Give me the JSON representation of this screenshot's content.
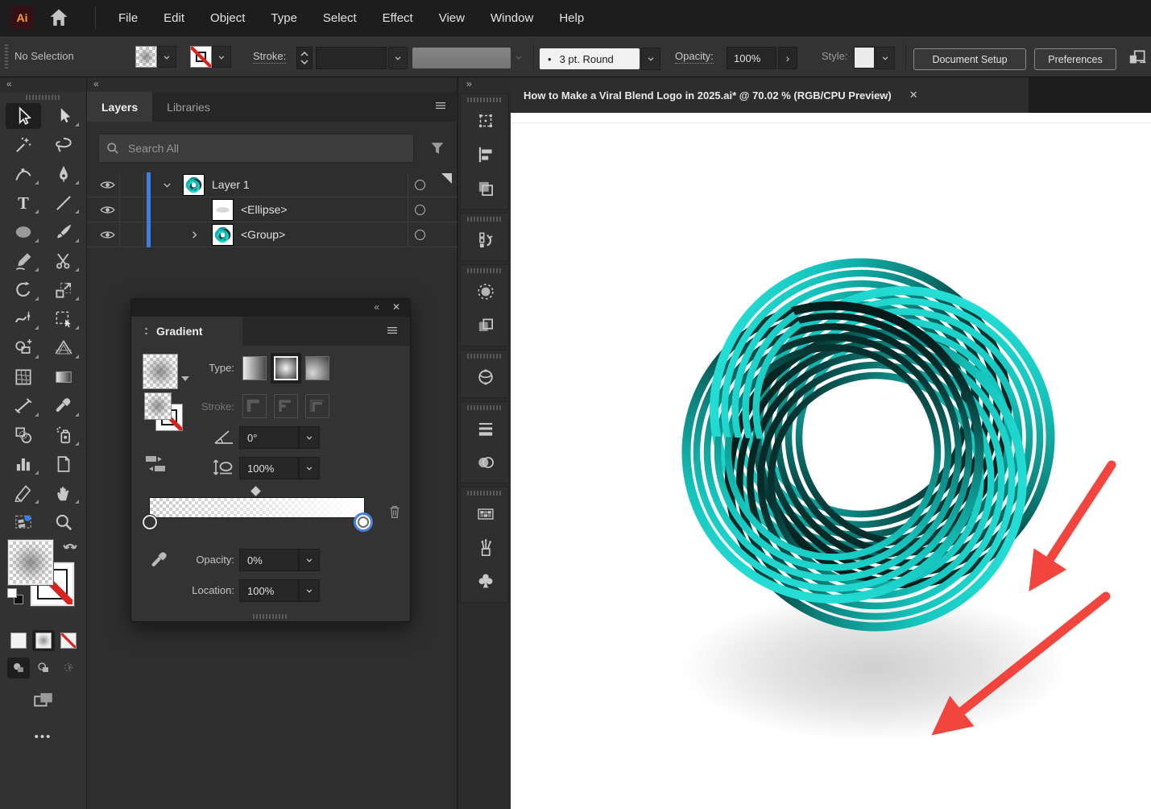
{
  "menu_bar": {
    "app_badge": "Ai",
    "items": [
      "File",
      "Edit",
      "Object",
      "Type",
      "Select",
      "Effect",
      "View",
      "Window",
      "Help"
    ]
  },
  "control_bar": {
    "selection_status": "No Selection",
    "stroke_label": "Stroke:",
    "stroke_point_bullet": "•",
    "stroke_point_label": "3 pt. Round",
    "opacity_label": "Opacity:",
    "opacity_value": "100%",
    "opacity_expand_glyph": "›",
    "style_label": "Style:",
    "document_setup_label": "Document Setup",
    "preferences_label": "Preferences"
  },
  "toolbar": {
    "collapse_glyph": "«",
    "tools": [
      {
        "name": "selection-tool",
        "active": true,
        "corner": false
      },
      {
        "name": "direct-selection-tool",
        "corner": true
      },
      {
        "name": "magic-wand-tool",
        "corner": false
      },
      {
        "name": "lasso-tool",
        "corner": false
      },
      {
        "name": "curvature-tool",
        "corner": true
      },
      {
        "name": "pen-tool",
        "corner": true
      },
      {
        "name": "type-tool",
        "corner": true
      },
      {
        "name": "line-segment-tool",
        "corner": true
      },
      {
        "name": "ellipse-tool",
        "corner": true
      },
      {
        "name": "paintbrush-tool",
        "corner": true
      },
      {
        "name": "shaper-tool",
        "corner": true
      },
      {
        "name": "scissors-tool",
        "corner": true
      },
      {
        "name": "rotate-tool",
        "corner": true
      },
      {
        "name": "scale-tool",
        "corner": true
      },
      {
        "name": "width-tool",
        "corner": true
      },
      {
        "name": "free-transform-tool",
        "corner": true
      },
      {
        "name": "shape-builder-tool",
        "corner": true
      },
      {
        "name": "perspective-grid-tool",
        "corner": true
      },
      {
        "name": "mesh-tool",
        "corner": false
      },
      {
        "name": "gradient-tool",
        "corner": false
      },
      {
        "name": "measure-tool",
        "corner": true
      },
      {
        "name": "eyedropper-tool",
        "corner": true
      },
      {
        "name": "blend-tool",
        "corner": false
      },
      {
        "name": "symbol-sprayer-tool",
        "corner": true
      },
      {
        "name": "column-graph-tool",
        "corner": true
      },
      {
        "name": "artboard-tool",
        "corner": false
      },
      {
        "name": "slice-tool",
        "corner": true
      },
      {
        "name": "hand-tool",
        "corner": true
      },
      {
        "name": "print-tiling-tool",
        "corner": false
      },
      {
        "name": "zoom-tool",
        "corner": false
      }
    ],
    "more_dots": "•••"
  },
  "layers_panel": {
    "collapse_glyph": "«",
    "tabs": [
      "Layers",
      "Libraries"
    ],
    "search_placeholder": "Search All",
    "rows": [
      {
        "label": "Layer 1",
        "thumb": "logo",
        "expander": "down",
        "indent": 0
      },
      {
        "label": "<Ellipse>",
        "thumb": "ellipse",
        "expander": "none",
        "indent": 1
      },
      {
        "label": "<Group>",
        "thumb": "logo",
        "expander": "right",
        "indent": 1
      }
    ]
  },
  "gradient_panel": {
    "collapse_glyph": "«",
    "close_glyph": "✕",
    "title": "Gradient",
    "type_label": "Type:",
    "stroke_label": "Stroke:",
    "angle_value": "0°",
    "aspect_value": "100%",
    "opacity_label": "Opacity:",
    "opacity_value": "0%",
    "location_label": "Location:",
    "location_value": "100%"
  },
  "right_dock": {
    "expand_glyph": "»",
    "groups": [
      [
        "transform-panel",
        "align-panel",
        "pathfinder-panel"
      ],
      [
        "history-panel"
      ],
      [
        "appearance-panel",
        "artboards-panel"
      ],
      [
        "3d-materials-panel"
      ],
      [
        "stroke-panel",
        "transparency-panel"
      ],
      [
        "swatches-panel",
        "brushes-panel",
        "symbols-panel"
      ]
    ]
  },
  "document": {
    "tab_title": "How to Make a Viral Blend Logo in 2025.ai* @ 70.02 % (RGB/CPU Preview)",
    "close_glyph": "✕"
  },
  "canvas": {
    "logo_colors": {
      "bright": "#2BEAE1",
      "mid": "#14C3BB",
      "deep": "#0E827D",
      "dark": "#073432",
      "black": "#041110"
    },
    "shadow_color": "#c4c4c4",
    "arrow_color": "#F2453D"
  }
}
